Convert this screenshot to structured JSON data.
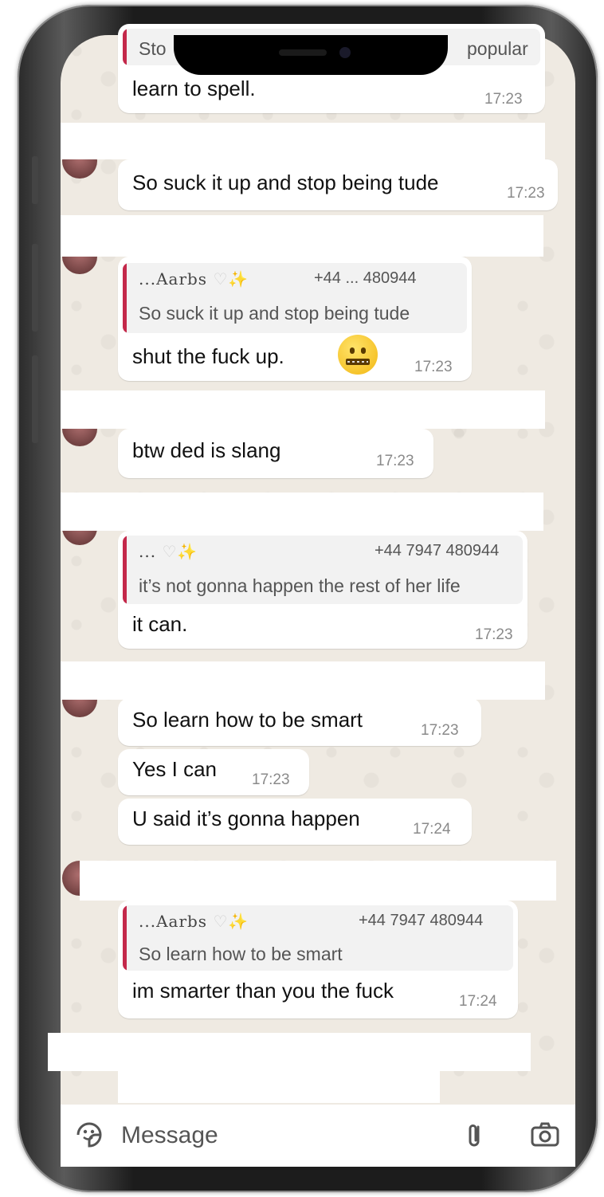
{
  "chat": {
    "messages": [
      {
        "quote_text_visible": "Sto",
        "quote_text_right": "popular",
        "text": "learn to spell.",
        "time": "17:23"
      },
      {
        "text": "So suck it up and stop being tude",
        "time": "17:23"
      },
      {
        "quote_sender": "...Aarbs",
        "quote_phone": "+44 ... 480944",
        "quote_text": "So suck it up and stop being tude",
        "text": "shut the fuck up.",
        "time": "17:23"
      },
      {
        "text": "btw ded is slang",
        "time": "17:23"
      },
      {
        "quote_sender": "...",
        "quote_phone": "+44 7947 480944",
        "quote_text": "it’s not gonna happen the rest of her life",
        "text": "it can.",
        "time": "17:23"
      },
      {
        "text": "So learn how to be smart",
        "time": "17:23"
      },
      {
        "text": "Yes I can",
        "time": "17:23"
      },
      {
        "text": "U said it’s gonna happen",
        "time": "17:24"
      },
      {
        "quote_sender": "...Aarbs",
        "quote_phone": "+44 7947 480944",
        "quote_text": "So learn how to be smart",
        "text": "im smarter than you the fuck",
        "time": "17:24"
      }
    ]
  },
  "input": {
    "placeholder": "Message"
  },
  "colors": {
    "chat_background": "#efeae2",
    "bubble": "#ffffff",
    "quote_bar": "#c4284a",
    "timestamp": "#8a8a8a"
  },
  "icons": [
    "emoji-sticker-icon",
    "attach-paperclip-icon",
    "camera-icon",
    "zipper-mouth-emoji"
  ]
}
